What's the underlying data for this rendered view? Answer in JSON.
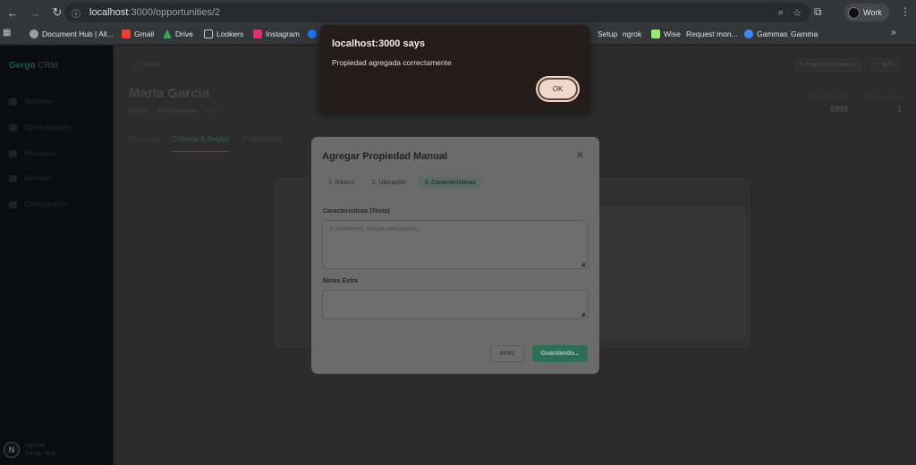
{
  "browser": {
    "url_host": "localhost",
    "url_rest": ":3000/opportunities/2",
    "profile_label": "Work",
    "bookmarks": [
      {
        "label": "Document Hub | All...",
        "color": "#9aa0a6"
      },
      {
        "label": "Gmail",
        "color": "#ea4335"
      },
      {
        "label": "Drive",
        "color": "#34a853"
      },
      {
        "label": "Lookers",
        "color": "#9aa0a6"
      },
      {
        "label": "Instagram",
        "color": "#e1306c"
      },
      {
        "label": "Setup",
        "color": "#9aa0a6"
      },
      {
        "label": "ngrok",
        "color": "#9aa0a6"
      },
      {
        "label": "Wise",
        "color": "#9fe870"
      },
      {
        "label": "Request mon...",
        "color": "#9aa0a6"
      },
      {
        "label": "Gammas",
        "color": "#4285f4"
      },
      {
        "label": "Gamma",
        "color": "#9aa0a6"
      }
    ]
  },
  "sidebar": {
    "brand_a": "Gergo",
    "brand_b": "CRM",
    "items": [
      {
        "label": "Sesiones"
      },
      {
        "label": "Oportunidades"
      },
      {
        "label": "Mensajes"
      },
      {
        "label": "Mensaje"
      },
      {
        "label": "Configuración"
      }
    ],
    "user_initial": "N",
    "user_name": "Agente",
    "user_email": "Gergo Hub"
  },
  "page": {
    "back_label": "← Volver",
    "btn_manual": "+ Propiedad Manual",
    "btn_more": "+ Más",
    "title": "Maria Garcia",
    "meta": [
      "Alquiler",
      "En Búsqueda",
      "1 dm"
    ],
    "stats": [
      {
        "label": "PRESUPUESTO",
        "value": "$800"
      },
      {
        "label": "PROPIEDADES",
        "value": "1"
      }
    ],
    "tabs": [
      "Resumen",
      "Criterios & Reglas",
      "Propiedades"
    ]
  },
  "modal": {
    "title": "Agregar Propiedad Manual",
    "steps": [
      "1. Básico",
      "2. Ubicación",
      "3. Características"
    ],
    "active_step": 2,
    "features_label": "Características (Texto)",
    "features_placeholder": "3 ambientes, balcón aterrazado...",
    "notes_label": "Notas Extra",
    "notes_value": "",
    "back_button": "Atrás",
    "save_button": "Guardando..."
  },
  "alert": {
    "title": "localhost:3000 says",
    "message": "Propiedad agregada correctamente",
    "ok_label": "OK"
  },
  "colors": {
    "accent": "#2e6d56",
    "ok_button": "#f3d7c8",
    "alert_bg": "#241c18"
  }
}
